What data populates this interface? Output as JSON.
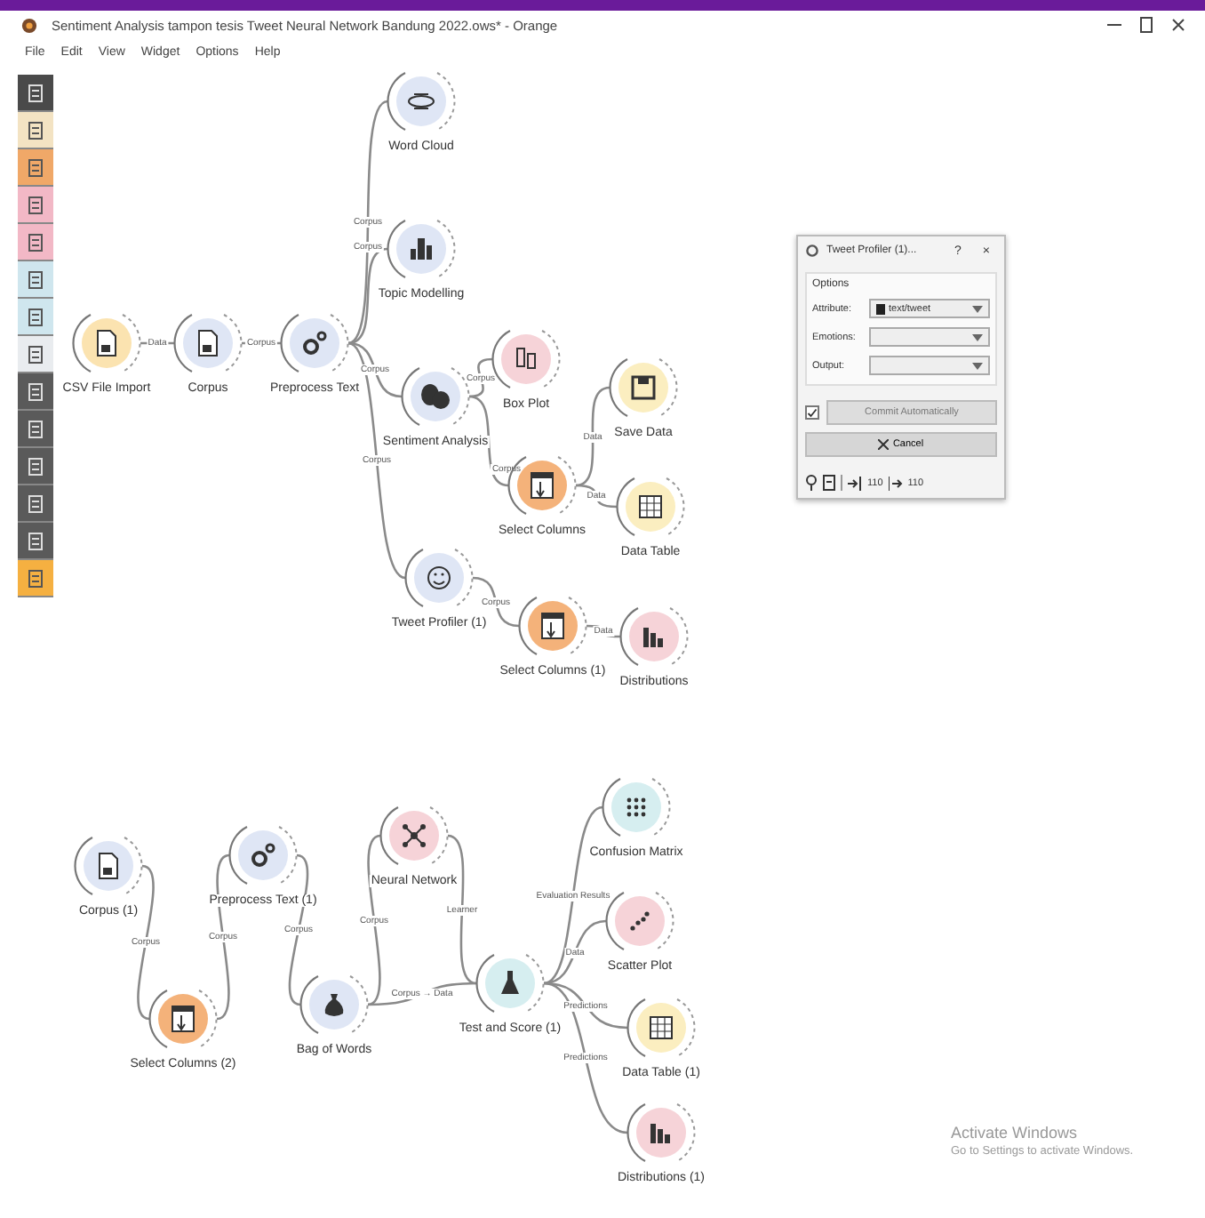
{
  "window": {
    "title": "Sentiment Analysis tampon tesis Tweet Neural Network Bandung 2022.ows* - Orange"
  },
  "menu": [
    "File",
    "Edit",
    "View",
    "Widget",
    "Options",
    "Help"
  ],
  "toolbox": [
    {
      "color": "#4a4a4a"
    },
    {
      "color": "#f3e3c3"
    },
    {
      "color": "#f0a868"
    },
    {
      "color": "#f2b8c6"
    },
    {
      "color": "#f2b8c6"
    },
    {
      "color": "#cfe6ee"
    },
    {
      "color": "#cfe6ee"
    },
    {
      "color": "#e9ecef"
    },
    {
      "color": "#5a5a5a"
    },
    {
      "color": "#5a5a5a"
    },
    {
      "color": "#5a5a5a"
    },
    {
      "color": "#5a5a5a"
    },
    {
      "color": "#5a5a5a"
    },
    {
      "color": "#f5b041"
    }
  ],
  "nodes": [
    {
      "label": "CSV File Import",
      "kind": "file",
      "color": "#fbe3b0"
    },
    {
      "label": "Corpus",
      "kind": "corpus",
      "color": "#dfe6f5"
    },
    {
      "label": "Preprocess Text",
      "kind": "gears",
      "color": "#dfe6f5"
    },
    {
      "label": "Word Cloud",
      "kind": "cloud",
      "color": "#dfe6f5"
    },
    {
      "label": "Topic Modelling",
      "kind": "people",
      "color": "#dfe6f5"
    },
    {
      "label": "Sentiment Analysis",
      "kind": "masks",
      "color": "#dfe6f5"
    },
    {
      "label": "Box Plot",
      "kind": "boxplot",
      "color": "#f6d3d8"
    },
    {
      "label": "Select Columns",
      "kind": "columns",
      "color": "#f4b27a"
    },
    {
      "label": "Save Data",
      "kind": "save",
      "color": "#fbeec0"
    },
    {
      "label": "Data Table",
      "kind": "table",
      "color": "#fbeec0"
    },
    {
      "label": "Tweet Profiler (1)",
      "kind": "smile",
      "color": "#dfe6f5"
    },
    {
      "label": "Select Columns (1)",
      "kind": "columns",
      "color": "#f4b27a"
    },
    {
      "label": "Distributions",
      "kind": "bars",
      "color": "#f6d3d8"
    },
    {
      "label": "Corpus (1)",
      "kind": "corpus",
      "color": "#dfe6f5"
    },
    {
      "label": "Select Columns (2)",
      "kind": "columns",
      "color": "#f4b27a"
    },
    {
      "label": "Preprocess Text (1)",
      "kind": "gears",
      "color": "#dfe6f5"
    },
    {
      "label": "Bag of Words",
      "kind": "bag",
      "color": "#dfe6f5"
    },
    {
      "label": "Neural Network",
      "kind": "network",
      "color": "#f6d3d8"
    },
    {
      "label": "Test and Score (1)",
      "kind": "flask",
      "color": "#d6eef0"
    },
    {
      "label": "Confusion Matrix",
      "kind": "matrix",
      "color": "#d6eef0"
    },
    {
      "label": "Scatter Plot",
      "kind": "scatter",
      "color": "#f6d3d8"
    },
    {
      "label": "Data Table (1)",
      "kind": "table",
      "color": "#fbeec0"
    },
    {
      "label": "Distributions (1)",
      "kind": "bars",
      "color": "#f6d3d8"
    }
  ],
  "links": [
    {
      "label": "Data"
    },
    {
      "label": "Corpus"
    },
    {
      "label": "Corpus"
    },
    {
      "label": "Corpus"
    },
    {
      "label": "Corpus"
    },
    {
      "label": "Corpus"
    },
    {
      "label": "Corpus"
    },
    {
      "label": "Corpus"
    },
    {
      "label": "Data"
    },
    {
      "label": "Data"
    },
    {
      "label": "Corpus"
    },
    {
      "label": "Data"
    },
    {
      "label": "Corpus"
    },
    {
      "label": "Corpus"
    },
    {
      "label": "Corpus"
    },
    {
      "label": "Corpus"
    },
    {
      "label": "Learner"
    },
    {
      "label": "Corpus → Data"
    },
    {
      "label": "Evaluation Results"
    },
    {
      "label": "Data"
    },
    {
      "label": "Predictions"
    },
    {
      "label": "Predictions"
    }
  ],
  "dialog": {
    "title": "Tweet Profiler (1)...",
    "help": "?",
    "close": "×",
    "group": "Options",
    "fields": [
      {
        "label": "Attribute:",
        "value": "text/tweet"
      },
      {
        "label": "Emotions:"
      },
      {
        "label": "Output:"
      }
    ],
    "auto_commit": {
      "label": "Commit Automatically",
      "checked": true
    },
    "cancel": "Cancel",
    "status": [
      "110",
      "110"
    ]
  },
  "overlay": {
    "title": "Activate Windows",
    "text": "Go to Settings to activate Windows."
  }
}
